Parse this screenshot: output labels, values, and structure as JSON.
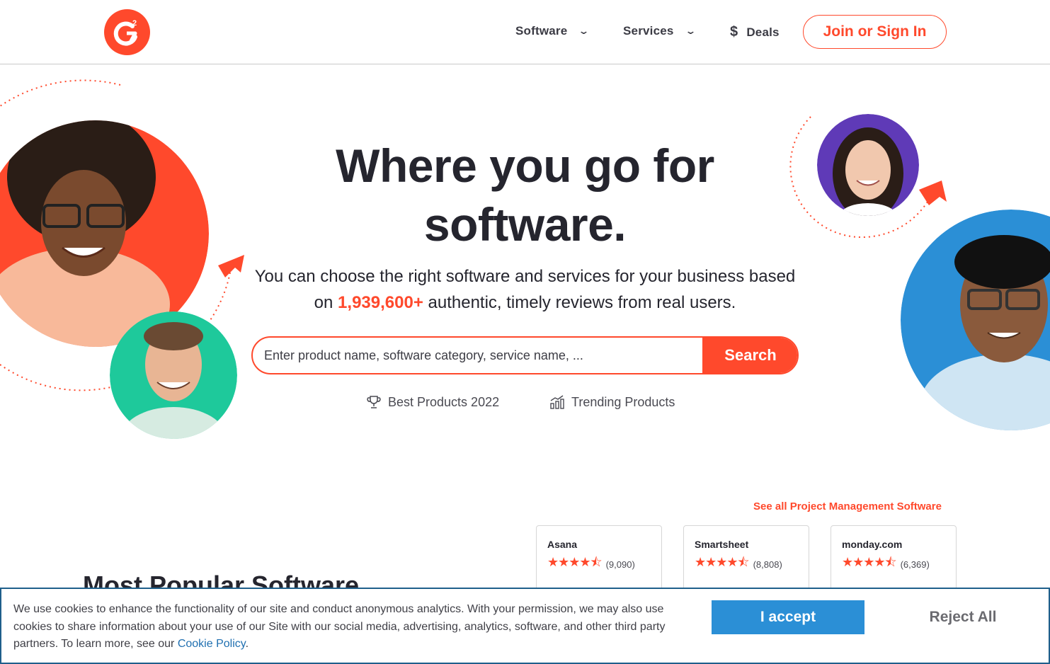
{
  "header": {
    "logo_label": "G2",
    "nav": [
      {
        "label": "Software"
      },
      {
        "label": "Services"
      },
      {
        "label": "Deals"
      }
    ],
    "join_label": "Join or Sign In"
  },
  "hero": {
    "title_line1": "Where you go for",
    "title_line2": "software.",
    "subtitle_pre": "You can choose the right software and services for your business based on ",
    "review_count": "1,939,600+",
    "subtitle_post": " authentic, timely reviews from real users.",
    "search": {
      "placeholder": "Enter product name, software category, service name, ...",
      "button_label": "Search"
    },
    "quick_links": [
      {
        "label": "Best Products 2022",
        "icon": "trophy-icon"
      },
      {
        "label": "Trending Products",
        "icon": "trending-chart-icon"
      }
    ]
  },
  "popular": {
    "heading": "Most Popular Software",
    "see_all": "See all Project Management Software",
    "products": [
      {
        "name": "Asana",
        "rating": 4.5,
        "reviews": "(9,090)"
      },
      {
        "name": "Smartsheet",
        "rating": 4.5,
        "reviews": "(8,808)"
      },
      {
        "name": "monday.com",
        "rating": 4.5,
        "reviews": "(6,369)"
      }
    ]
  },
  "cookie": {
    "text": "We use cookies to enhance the functionality of our site and conduct anonymous analytics. With your permission, we may also use cookies to share information about your use of our Site with our social media, advertising, analytics, software, and other third party partners. To learn more, see our ",
    "link_label": "Cookie Policy",
    "text_end": ".",
    "accept_label": "I accept",
    "reject_label": "Reject All"
  },
  "colors": {
    "brand": "#ff492c",
    "accept": "#2b8fd6",
    "banner_border": "#1f5f8b"
  }
}
